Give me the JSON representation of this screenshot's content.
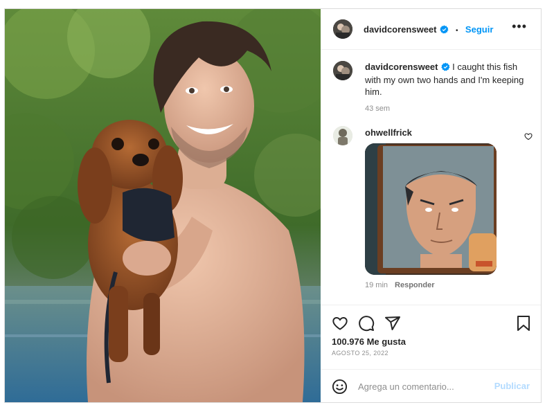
{
  "post": {
    "author": "davidcorensweet",
    "follow_label": "Seguir",
    "separator": "•",
    "more_label": "•••",
    "caption_user": "davidcorensweet",
    "caption_text": " I caught this fish with my own two hands and I'm keeping him.",
    "caption_age": "43 sem"
  },
  "comment": {
    "user": "ohwellfrick",
    "age": "19 min",
    "reply_label": "Responder"
  },
  "stats": {
    "likes": "100.976 Me gusta",
    "date": "AGOSTO 25, 2022"
  },
  "composer": {
    "placeholder": "Agrega un comentario...",
    "publish_label": "Publicar"
  },
  "colors": {
    "accent": "#0095f6",
    "verified": "#0095f6",
    "publish_disabled": "#b3dbff"
  },
  "icons": [
    "verified-badge-icon",
    "more-options-icon",
    "like-icon",
    "comment-icon",
    "share-icon",
    "save-icon",
    "emoji-icon",
    "comment-like-icon"
  ]
}
